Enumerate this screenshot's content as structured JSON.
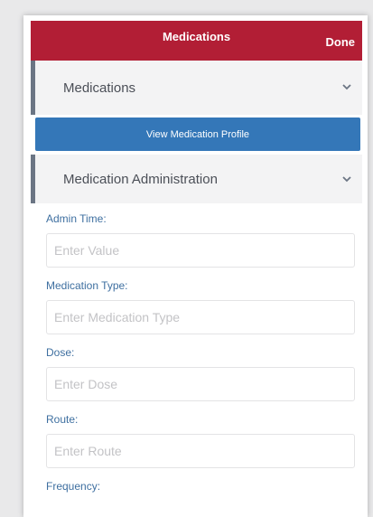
{
  "header": {
    "title": "Medications",
    "done_label": "Done"
  },
  "sections": [
    {
      "label": "Medications",
      "icon": "chevron-down-icon"
    },
    {
      "label": "Medication Administration",
      "icon": "chevron-down-icon"
    }
  ],
  "profile_button": {
    "label": "View Medication Profile"
  },
  "form": {
    "fields": [
      {
        "label": "Admin Time:",
        "placeholder": "Enter Value",
        "value": ""
      },
      {
        "label": "Medication Type:",
        "placeholder": "Enter Medication Type",
        "value": ""
      },
      {
        "label": "Dose:",
        "placeholder": "Enter Dose",
        "value": ""
      },
      {
        "label": "Route:",
        "placeholder": "Enter Route",
        "value": ""
      },
      {
        "label": "Frequency:",
        "placeholder": "",
        "value": ""
      }
    ]
  },
  "colors": {
    "header_bg": "#b21e35",
    "button_bg": "#3477b8",
    "label_color": "#3e6fa0"
  }
}
